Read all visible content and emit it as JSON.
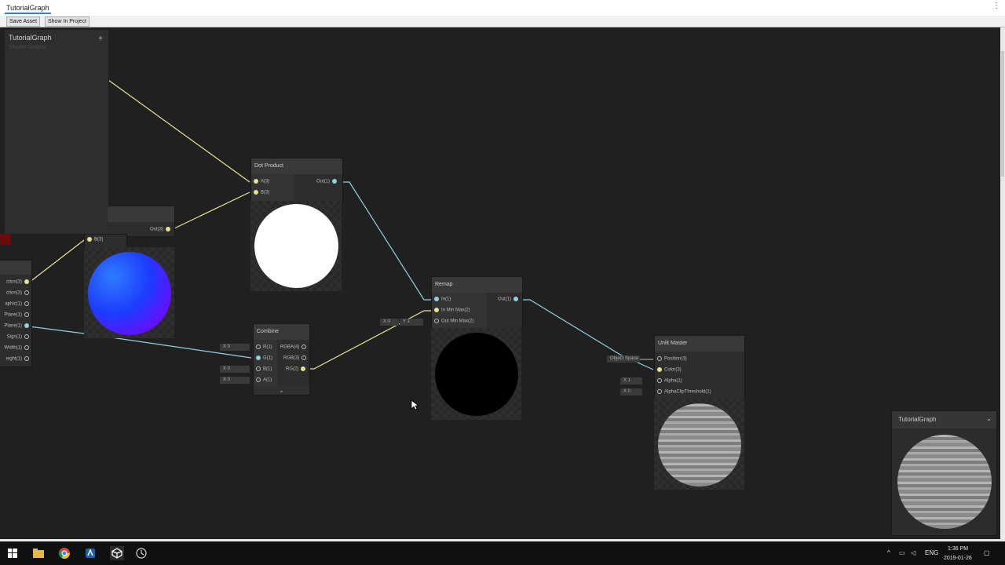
{
  "window": {
    "title": "TutorialGraph"
  },
  "toolbar": {
    "save_label": "Save Asset",
    "show_label": "Show In Project"
  },
  "blackboard": {
    "title": "TutorialGraph",
    "subtitle": "Shader Graphs",
    "add_label": "+"
  },
  "partial_node": {
    "out_label": "Out(3)",
    "b_label": "B(3)",
    "ports": [
      "ction(3)",
      "ction(3)",
      "aphic(1)",
      "Plane(1)",
      "Plane(1)",
      "Sign(1)",
      "Width(1)",
      "eight(1)"
    ]
  },
  "dot_product": {
    "title": "Dot Product",
    "in_a": "A(3)",
    "in_b": "B(3)",
    "out": "Out(1)"
  },
  "combine": {
    "title": "Combine",
    "inputs": [
      "R(1)",
      "G(1)",
      "B(1)",
      "A(1)"
    ],
    "outputs": [
      "RGBA(4)",
      "RGB(3)",
      "RG(2)"
    ],
    "fields": [
      "X 0",
      "X 0",
      "X 0"
    ]
  },
  "remap": {
    "title": "Remap",
    "in": "In(1)",
    "in_min_max": "In Min Max(2)",
    "out_min_max": "Out Min Max(2)",
    "out": "Out(1)",
    "field_x": "X 0",
    "field_y": "Y 1"
  },
  "unlit_master": {
    "title": "Unlit Master",
    "inputs": [
      "Position(3)",
      "Color(3)",
      "Alpha(1)",
      "AlphaClipThreshold(1)"
    ],
    "position_field": "Object Space",
    "alpha_field": "X 1",
    "alpha_clip_field": "X 0"
  },
  "main_preview": {
    "title": "TutorialGraph",
    "collapse_icon": "chevron-down-icon"
  },
  "taskbar": {
    "icons": [
      "windows-start-icon",
      "file-explorer-icon",
      "chrome-icon",
      "app-icon",
      "unity-icon",
      "app-icon"
    ],
    "language": "ENG",
    "time": "1:36 PM",
    "date": "2019-01-26"
  },
  "colors": {
    "wire_yellow": "#e8e392",
    "wire_cyan": "#8fd3e0",
    "canvas": "#202020"
  }
}
